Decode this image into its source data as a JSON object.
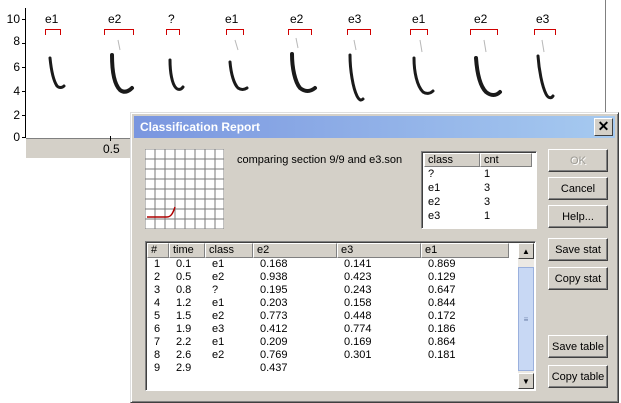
{
  "spectrogram": {
    "y_ticks": [
      "10",
      "8",
      "6",
      "4",
      "2",
      "0"
    ],
    "x_ticks": [
      "0.5"
    ],
    "segments": [
      "e1",
      "e2",
      "?",
      "e1",
      "e2",
      "e3",
      "e1",
      "e2",
      "e3"
    ],
    "segment_color": "#d00000"
  },
  "dialog": {
    "title": "Classification Report",
    "close_icon": "close-icon",
    "comparing_text": "comparing section 9/9 and e3.son",
    "class_table": {
      "headers": [
        "class",
        "cnt"
      ],
      "rows": [
        {
          "class": "?",
          "cnt": "1"
        },
        {
          "class": "e1",
          "cnt": "3"
        },
        {
          "class": "e2",
          "cnt": "3"
        },
        {
          "class": "e3",
          "cnt": "1"
        }
      ]
    },
    "buttons": {
      "ok": "OK",
      "cancel": "Cancel",
      "help": "Help...",
      "save_stat": "Save stat",
      "copy_stat": "Copy stat",
      "save_table": "Save table",
      "copy_table": "Copy table"
    },
    "results_table": {
      "headers": [
        "#",
        "time",
        "class",
        "e2",
        "e3",
        "e1"
      ],
      "rows": [
        {
          "n": "1",
          "time": "0.1",
          "class": "e1",
          "e2": "0.168",
          "e3": "0.141",
          "e1": "0.869"
        },
        {
          "n": "2",
          "time": "0.5",
          "class": "e2",
          "e2": "0.938",
          "e3": "0.423",
          "e1": "0.129"
        },
        {
          "n": "3",
          "time": "0.8",
          "class": "?",
          "e2": "0.195",
          "e3": "0.243",
          "e1": "0.647"
        },
        {
          "n": "4",
          "time": "1.2",
          "class": "e1",
          "e2": "0.203",
          "e3": "0.158",
          "e1": "0.844"
        },
        {
          "n": "5",
          "time": "1.5",
          "class": "e2",
          "e2": "0.773",
          "e3": "0.448",
          "e1": "0.172"
        },
        {
          "n": "6",
          "time": "1.9",
          "class": "e3",
          "e2": "0.412",
          "e3": "0.774",
          "e1": "0.186"
        },
        {
          "n": "7",
          "time": "2.2",
          "class": "e1",
          "e2": "0.209",
          "e3": "0.169",
          "e1": "0.864"
        },
        {
          "n": "8",
          "time": "2.6",
          "class": "e2",
          "e2": "0.769",
          "e3": "0.301",
          "e1": "0.181"
        },
        {
          "n": "9",
          "time": "2.9",
          "class": "",
          "e2": "0.437",
          "e3": "",
          "e1": ""
        }
      ]
    }
  }
}
